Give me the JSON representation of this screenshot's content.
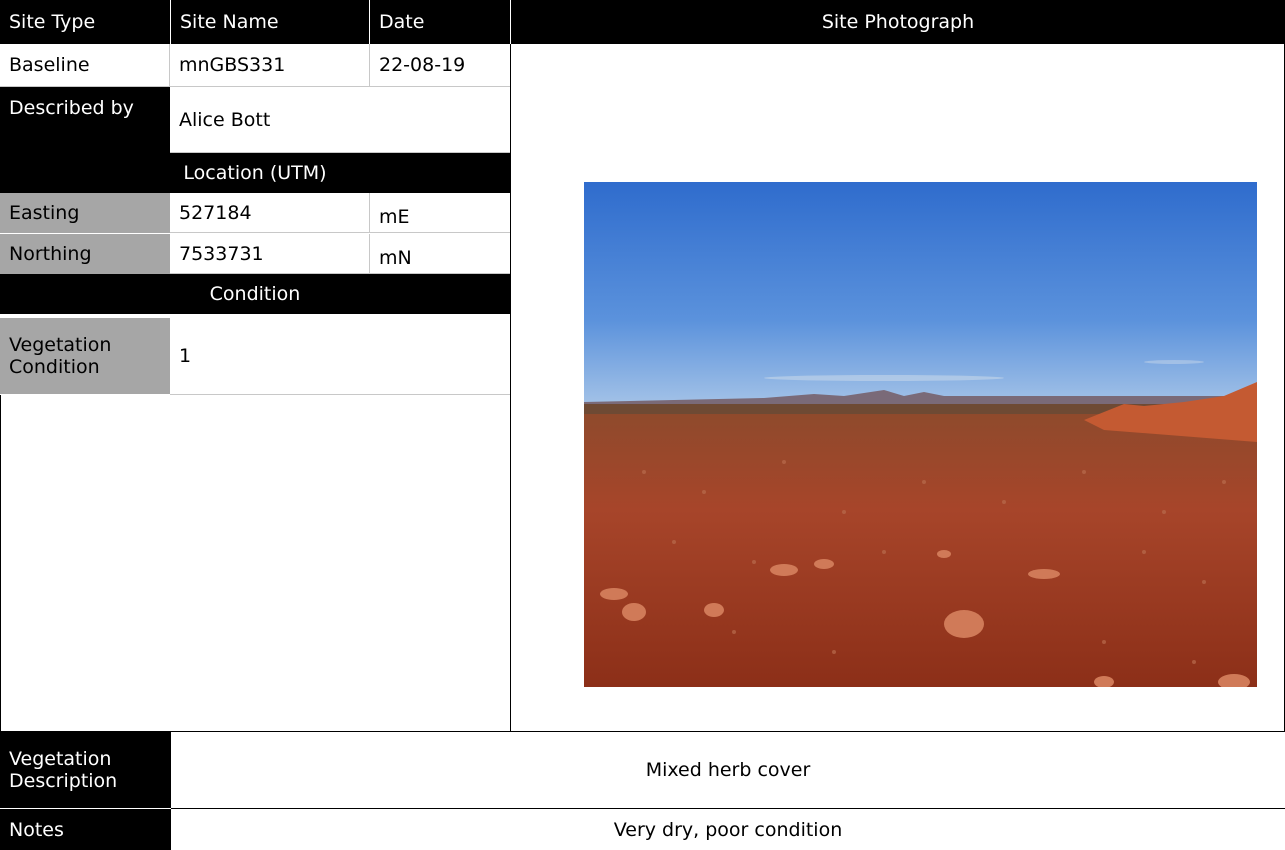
{
  "header": {
    "site_type": "Site Type",
    "site_name": "Site Name",
    "date": "Date",
    "site_photograph": "Site Photograph"
  },
  "site": {
    "type": "Baseline",
    "name": "mnGBS331",
    "date": "22-08-19"
  },
  "described_by": {
    "label": "Described by",
    "value": "Alice Bott"
  },
  "location": {
    "heading": "Location (UTM)",
    "easting_label": "Easting",
    "easting_value": "527184",
    "easting_unit": "mE",
    "northing_label": "Northing",
    "northing_value": "7533731",
    "northing_unit": "mN"
  },
  "condition": {
    "heading": "Condition",
    "vegetation_label": "Vegetation Condition",
    "vegetation_value": "1"
  },
  "vegetation_description": {
    "label": "Vegetation Description",
    "value": "Mixed herb cover"
  },
  "notes": {
    "label": "Notes",
    "value": "Very dry, poor condition"
  },
  "colors": {
    "header_bg": "#000000",
    "label_gray": "#a6a6a6",
    "sky": "#3f78d2",
    "ground": "#9b3a1e"
  }
}
